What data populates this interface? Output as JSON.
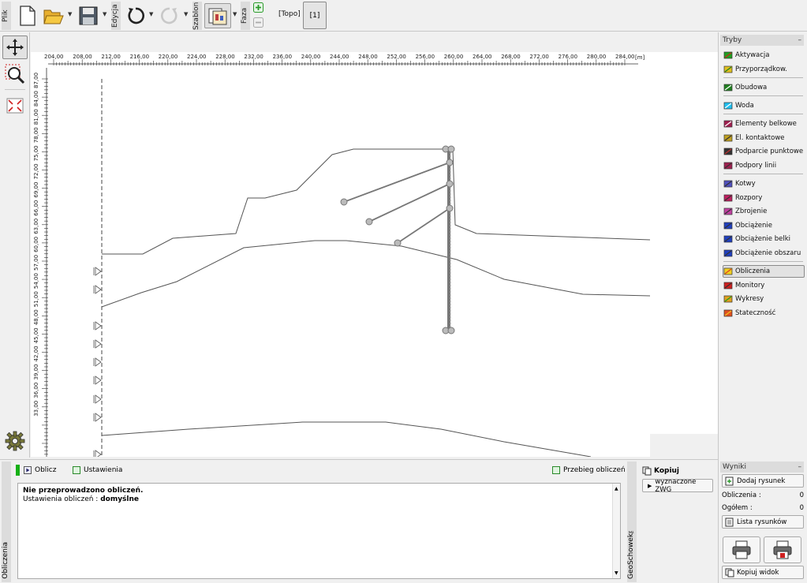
{
  "toolbar": {
    "file_label": "Plik",
    "edit_label": "Edycja",
    "template_label": "Szablon",
    "phase_label": "Faza",
    "topo_label": "[Topo]",
    "phase_number": "[1]"
  },
  "ruler": {
    "unit": "[m]",
    "x_ticks": [
      "204,00",
      "208,00",
      "212,00",
      "216,00",
      "220,00",
      "224,00",
      "228,00",
      "232,00",
      "236,00",
      "240,00",
      "244,00",
      "248,00",
      "252,00",
      "256,00",
      "260,00",
      "264,00",
      "268,00",
      "272,00",
      "276,00",
      "280,00",
      "284,00"
    ],
    "y_ticks": [
      "87,00",
      "84,00",
      "81,00",
      "78,00",
      "75,00",
      "72,00",
      "69,00",
      "66,00",
      "63,00",
      "60,00",
      "57,00",
      "54,00",
      "51,00",
      "48,00",
      "45,00",
      "42,00",
      "39,00",
      "36,00",
      "33,00"
    ]
  },
  "modes": {
    "title": "Tryby",
    "minimize": "–",
    "items": [
      {
        "label": "Aktywacja",
        "icon": "activation-icon"
      },
      {
        "label": "Przyporządkow.",
        "icon": "assign-icon"
      },
      {
        "label": "Obudowa",
        "icon": "lining-icon"
      },
      {
        "label": "Woda",
        "icon": "water-icon"
      },
      {
        "label": "Elementy belkowe",
        "icon": "beam-icon"
      },
      {
        "label": "El. kontaktowe",
        "icon": "contact-icon"
      },
      {
        "label": "Podparcie punktowe",
        "icon": "point-support-icon"
      },
      {
        "label": "Podpory linii",
        "icon": "line-support-icon"
      },
      {
        "label": "Kotwy",
        "icon": "anchor-icon"
      },
      {
        "label": "Rozpory",
        "icon": "strut-icon"
      },
      {
        "label": "Zbrojenie",
        "icon": "reinforcement-icon"
      },
      {
        "label": "Obciążenie",
        "icon": "load-icon"
      },
      {
        "label": "Obciążenie belki",
        "icon": "beam-load-icon"
      },
      {
        "label": "Obciążenie obszaru",
        "icon": "region-load-icon"
      },
      {
        "label": "Obliczenia",
        "icon": "analysis-icon"
      },
      {
        "label": "Monitory",
        "icon": "monitor-icon"
      },
      {
        "label": "Wykresy",
        "icon": "graph-icon"
      },
      {
        "label": "Stateczność",
        "icon": "stability-icon"
      }
    ]
  },
  "bottom": {
    "side_label": "Obliczenia",
    "compute_label": "Oblicz",
    "settings_label": "Ustawienia",
    "progress_label": "Przebieg obliczeń",
    "status_line": "Nie przeprowadzono obliczeń.",
    "settings_prefix": "Ustawienia obliczeń : ",
    "settings_value": "domyślne",
    "geo_label": "GeoSchowek™",
    "copy_label": "Kopiuj",
    "zwg_label": "wyznaczone ZWG"
  },
  "results": {
    "title": "Wyniki",
    "minimize": "–",
    "add_drawing": "Dodaj rysunek",
    "calc_label": "Obliczenia :",
    "calc_value": "0",
    "total_label": "Ogółem :",
    "total_value": "0",
    "list_label": "Lista rysunków",
    "copy_view": "Kopiuj widok"
  }
}
